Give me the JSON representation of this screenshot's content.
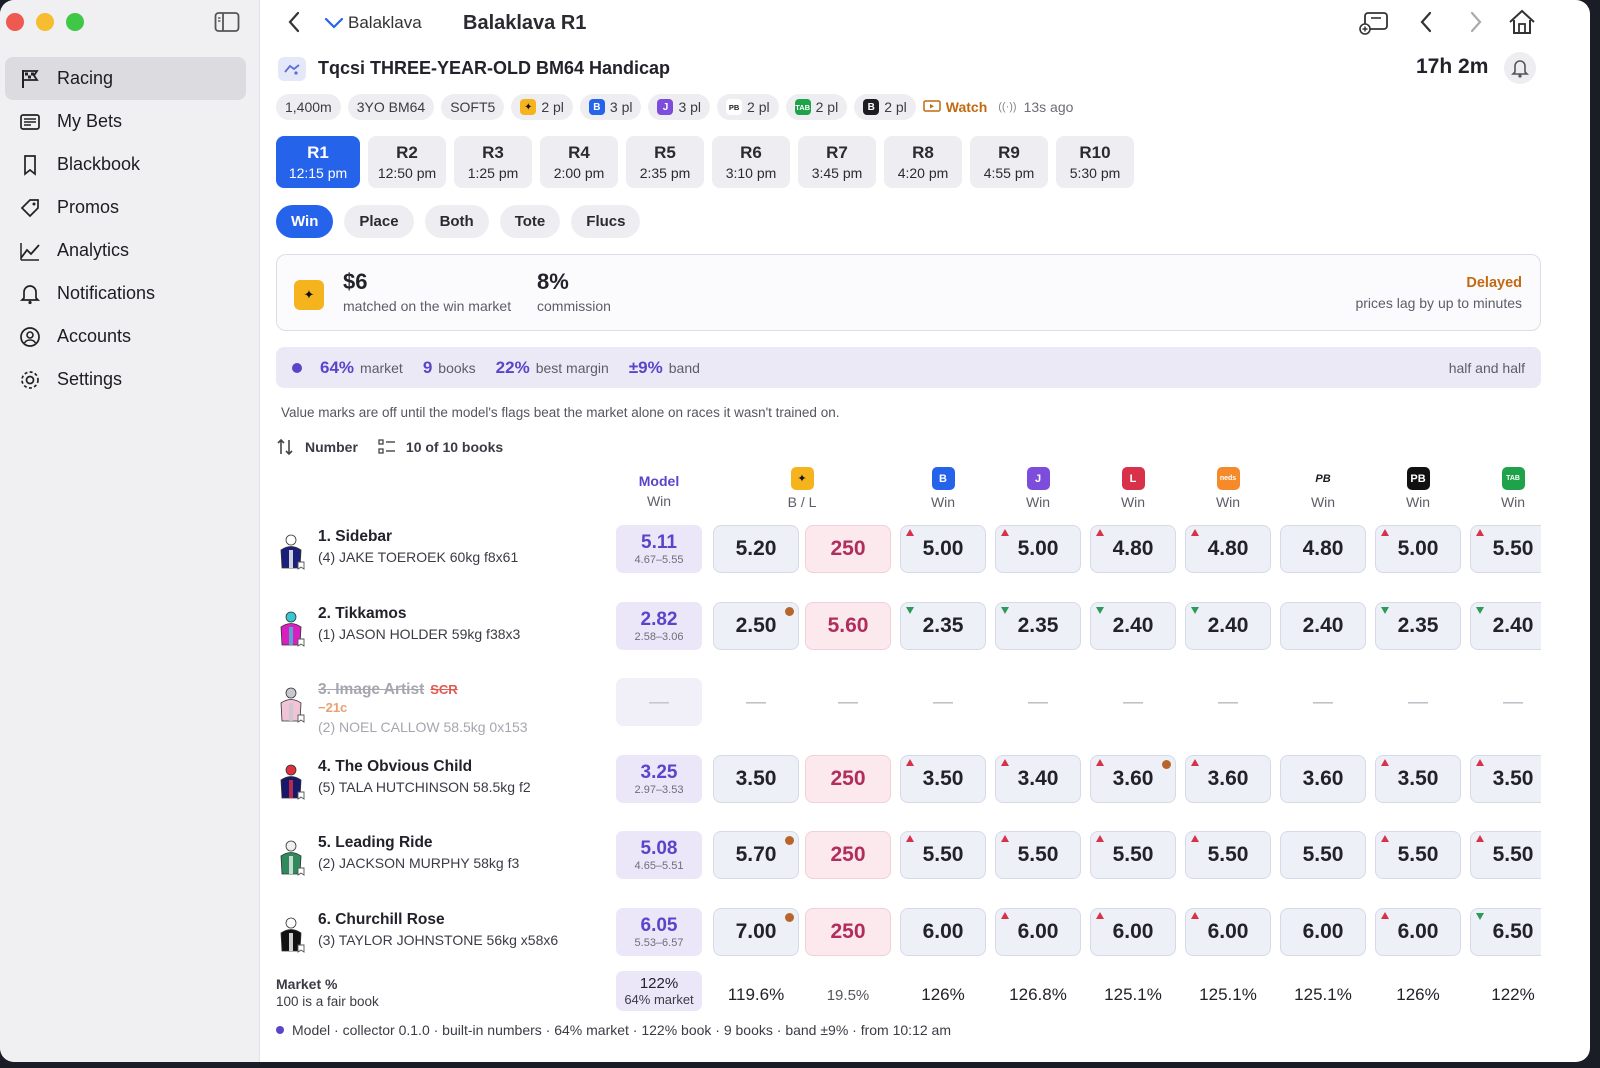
{
  "window": {
    "controls": [
      "close",
      "minimize",
      "zoom"
    ]
  },
  "sidebar": {
    "items": [
      {
        "label": "Racing",
        "icon": "flag-icon",
        "active": true
      },
      {
        "label": "My Bets",
        "icon": "receipt-icon"
      },
      {
        "label": "Blackbook",
        "icon": "bookmark-icon"
      },
      {
        "label": "Promos",
        "icon": "tag-icon"
      },
      {
        "label": "Analytics",
        "icon": "chart-icon"
      },
      {
        "label": "Notifications",
        "icon": "bell-icon"
      },
      {
        "label": "Accounts",
        "icon": "person-circle-icon"
      },
      {
        "label": "Settings",
        "icon": "gear-icon"
      }
    ]
  },
  "topbar": {
    "venue": "Balaklava",
    "title": "Balaklava R1"
  },
  "race": {
    "name": "Tqcsi THREE-YEAR-OLD BM64 Handicap",
    "countdown": "17h 2m"
  },
  "chips": [
    {
      "label": "1,400m"
    },
    {
      "label": "3YO BM64"
    },
    {
      "label": "SOFT5"
    },
    {
      "label": "2 pl",
      "book": "betfair",
      "color": "#f5b41e",
      "glyph": "✦"
    },
    {
      "label": "3 pl",
      "book": "blue-b",
      "color": "#2563eb",
      "glyph": "B"
    },
    {
      "label": "3 pl",
      "book": "purple",
      "color": "#7c4ddb",
      "glyph": "J"
    },
    {
      "label": "2 pl",
      "book": "pb",
      "color": "#ffffff",
      "glyph": "PB"
    },
    {
      "label": "2 pl",
      "book": "tab",
      "color": "#1fa34a",
      "glyph": "TAB"
    },
    {
      "label": "2 pl",
      "book": "dark",
      "color": "#1c1c22",
      "glyph": "B"
    }
  ],
  "watch": {
    "label": "Watch",
    "ago": "13s ago"
  },
  "races": [
    {
      "n": "R1",
      "t": "12:15 pm",
      "selected": true
    },
    {
      "n": "R2",
      "t": "12:50 pm"
    },
    {
      "n": "R3",
      "t": "1:25 pm"
    },
    {
      "n": "R4",
      "t": "2:00 pm"
    },
    {
      "n": "R5",
      "t": "2:35 pm"
    },
    {
      "n": "R6",
      "t": "3:10 pm"
    },
    {
      "n": "R7",
      "t": "3:45 pm"
    },
    {
      "n": "R8",
      "t": "4:20 pm"
    },
    {
      "n": "R9",
      "t": "4:55 pm"
    },
    {
      "n": "R10",
      "t": "5:30 pm"
    }
  ],
  "tabs": [
    {
      "label": "Win",
      "selected": true
    },
    {
      "label": "Place"
    },
    {
      "label": "Both"
    },
    {
      "label": "Tote"
    },
    {
      "label": "Flucs"
    }
  ],
  "exchange": {
    "matched": "$6",
    "matched_sub": "matched on the win market",
    "commission": "8%",
    "commission_sub": "commission",
    "status": "Delayed",
    "status_sub": "prices lag by up to minutes"
  },
  "stats": {
    "market": "64%",
    "market_l": "market",
    "books": "9",
    "books_l": "books",
    "margin": "22%",
    "margin_l": "best margin",
    "band": "±9%",
    "band_l": "band",
    "mode": "half and half"
  },
  "note": "Value marks are off until the model's flags beat the market alone on races it wasn't trained on.",
  "sort": {
    "label": "Number",
    "books": "10 of 10 books"
  },
  "columns": {
    "model": {
      "title": "Model",
      "sub": "Win"
    },
    "books": [
      {
        "sub": "B / L",
        "color": "#f5b41e",
        "glyph": "✦",
        "fg": "#111"
      },
      {
        "sub": "Win",
        "color": "#2563eb",
        "glyph": "B",
        "fg": "#fff"
      },
      {
        "sub": "Win",
        "color": "#7c4ddb",
        "glyph": "J",
        "fg": "#fff"
      },
      {
        "sub": "Win",
        "color": "#d8314a",
        "glyph": "L",
        "fg": "#fff"
      },
      {
        "sub": "Win",
        "color": "#f58a2b",
        "glyph": "neds",
        "fg": "#fff"
      },
      {
        "sub": "Win",
        "color": "#ffffff",
        "glyph": "PB",
        "fg": "#1c1c22"
      },
      {
        "sub": "Win",
        "color": "#111111",
        "glyph": "PB",
        "fg": "#fff"
      },
      {
        "sub": "Win",
        "color": "#1fa34a",
        "glyph": "TAB",
        "fg": "#fff"
      }
    ]
  },
  "runners": [
    {
      "name": "1. Sidebar",
      "info": "(4)  JAKE TOEROEK  60kg  f8x61",
      "model": "5.11",
      "range": "4.67–5.55",
      "back": "5.20",
      "back_dot": false,
      "lay": "250",
      "prices": [
        {
          "v": "5.00",
          "m": "up"
        },
        {
          "v": "5.00",
          "m": "up"
        },
        {
          "v": "4.80",
          "m": "up"
        },
        {
          "v": "4.80",
          "m": "up"
        },
        {
          "v": "4.80",
          "m": ""
        },
        {
          "v": "5.00",
          "m": "up"
        },
        {
          "v": "5.50",
          "m": "up"
        }
      ],
      "silk": [
        "#1a1f7a",
        "#ffffff"
      ]
    },
    {
      "name": "2. Tikkamos",
      "info": "(1)  JASON HOLDER  59kg  f38x3",
      "model": "2.82",
      "range": "2.58–3.06",
      "back": "2.50",
      "back_dot": true,
      "lay": "5.60",
      "prices": [
        {
          "v": "2.35",
          "m": "dn"
        },
        {
          "v": "2.35",
          "m": "dn"
        },
        {
          "v": "2.40",
          "m": "dn"
        },
        {
          "v": "2.40",
          "m": "dn"
        },
        {
          "v": "2.40",
          "m": ""
        },
        {
          "v": "2.35",
          "m": "dn"
        },
        {
          "v": "2.40",
          "m": "dn"
        }
      ],
      "silk": [
        "#d81fc0",
        "#38c6d0"
      ]
    },
    {
      "name": "3. Image Artist",
      "scr": "SCR",
      "drift": "−21c",
      "info": "(2)  NOEL CALLOW  58.5kg  0x153",
      "model": "—",
      "scratched": true,
      "silk": [
        "#f0c4d6",
        "#c8c8d0"
      ]
    },
    {
      "name": "4. The Obvious Child",
      "info": "(5)  TALA HUTCHINSON  58.5kg  f2",
      "model": "3.25",
      "range": "2.97–3.53",
      "back": "3.50",
      "back_dot": false,
      "lay": "250",
      "prices": [
        {
          "v": "3.50",
          "m": "up"
        },
        {
          "v": "3.40",
          "m": "up"
        },
        {
          "v": "3.60",
          "m": "up",
          "dot": true
        },
        {
          "v": "3.60",
          "m": "up"
        },
        {
          "v": "3.60",
          "m": ""
        },
        {
          "v": "3.50",
          "m": "up"
        },
        {
          "v": "3.50",
          "m": "up"
        }
      ],
      "silk": [
        "#18186a",
        "#e03040"
      ]
    },
    {
      "name": "5. Leading Ride",
      "info": "(2)  JACKSON MURPHY  58kg  f3",
      "model": "5.08",
      "range": "4.65–5.51",
      "back": "5.70",
      "back_dot": true,
      "lay": "250",
      "prices": [
        {
          "v": "5.50",
          "m": "up"
        },
        {
          "v": "5.50",
          "m": "up"
        },
        {
          "v": "5.50",
          "m": "up"
        },
        {
          "v": "5.50",
          "m": "up"
        },
        {
          "v": "5.50",
          "m": ""
        },
        {
          "v": "5.50",
          "m": "up"
        },
        {
          "v": "5.50",
          "m": "up"
        }
      ],
      "silk": [
        "#2e8a5a",
        "#f0f0f0"
      ]
    },
    {
      "name": "6. Churchill Rose",
      "info": "(3)  TAYLOR JOHNSTONE  56kg  x58x6",
      "model": "6.05",
      "range": "5.53–6.57",
      "back": "7.00",
      "back_dot": true,
      "lay": "250",
      "prices": [
        {
          "v": "6.00",
          "m": ""
        },
        {
          "v": "6.00",
          "m": "up"
        },
        {
          "v": "6.00",
          "m": "up"
        },
        {
          "v": "6.00",
          "m": "up"
        },
        {
          "v": "6.00",
          "m": ""
        },
        {
          "v": "6.00",
          "m": "up"
        },
        {
          "v": "6.50",
          "m": "dn"
        }
      ],
      "silk": [
        "#111111",
        "#ffffff"
      ]
    }
  ],
  "market_row": {
    "label": "Market %",
    "sub": "100 is a fair book",
    "model": "122%",
    "model_sub": "64% market",
    "values": [
      "119.6%",
      "19.5%",
      "126%",
      "126.8%",
      "125.1%",
      "125.1%",
      "125.1%",
      "126%",
      "122%"
    ]
  },
  "footer": "Model · collector 0.1.0 · built-in numbers · 64% market · 122% book · 9 books · band ±9% · from 10:12 am"
}
